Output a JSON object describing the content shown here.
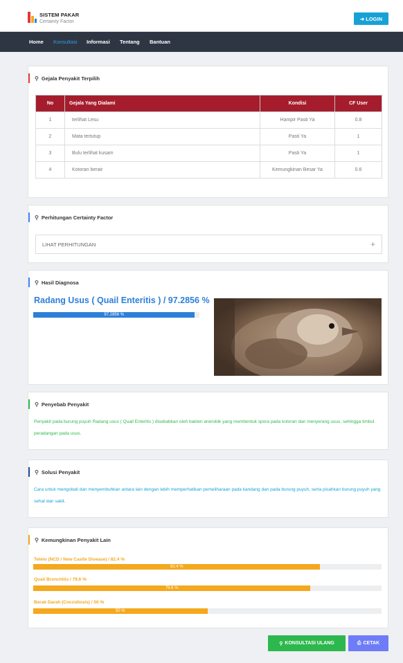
{
  "header": {
    "title": "SISTEM PAKAR",
    "subtitle": "Certainty Factor",
    "login_label": "LOGIN",
    "login_icon": "sign-in-icon"
  },
  "nav": {
    "items": [
      {
        "label": "Home"
      },
      {
        "label": "Konsultasi"
      },
      {
        "label": "Informasi"
      },
      {
        "label": "Tentang"
      },
      {
        "label": "Bantuan"
      }
    ]
  },
  "gejala": {
    "title": "Gejala Penyakit Terpilih",
    "columns": [
      "No",
      "Gejala Yang Dialami",
      "Kondisi",
      "CF User"
    ],
    "rows": [
      {
        "no": "1",
        "gejala": "terlihat Lesu",
        "kondisi": "Hampir Pasti Ya",
        "cf": "0.8"
      },
      {
        "no": "2",
        "gejala": "Mata tertutup",
        "kondisi": "Pasti Ya",
        "cf": "1"
      },
      {
        "no": "3",
        "gejala": "Bulu terlihat kusam",
        "kondisi": "Pasti Ya",
        "cf": "1"
      },
      {
        "no": "4",
        "gejala": "Kotoran berair",
        "kondisi": "Kemungkinan Besar Ya",
        "cf": "0.6"
      }
    ]
  },
  "perhitungan": {
    "title": "Perhitungan Certainty Factor",
    "accordion_label": "LIHAT PERHITUNGAN",
    "accordion_icon": "+"
  },
  "hasil": {
    "title": "Hasil Diagnosa",
    "diagnosis": "Radang Usus ( Quail Enteritis ) / 97.2856 %",
    "progress_value": 97.2856,
    "progress_label": "97.2856 %",
    "image_alt": "quail-photo"
  },
  "penyebab": {
    "title": "Penyebab Penyakit",
    "text": "Penyakit pada burung puyuh Radang usus ( Quail Enteritis ) disebabkan oleh bakteri anerobik yang membentuk spora pada kotoran dan menyerang usus, sehingga timbul peradangan pada usus."
  },
  "solusi": {
    "title": "Solusi Penyakit",
    "text": "Cara untuk mengobati dan menyembuhkan antara lain dengan lebih memperhatikan pemeliharaan pada kandang dan pada burung puyuh, serta pisahkan burung puyuh yang sehat dan sakit."
  },
  "lain": {
    "title": "Kemungkinan Penyakit Lain",
    "items": [
      {
        "label": "Tetelo (NCD / New Castle Disease) / 82.4 %",
        "value": 82.4,
        "bar_label": "82.4 %"
      },
      {
        "label": "Quail Bronchitis / 79.6 %",
        "value": 79.6,
        "bar_label": "79.6 %"
      },
      {
        "label": "Berak Darah (Coccidiosis) / 50 %",
        "value": 50,
        "bar_label": "50 %"
      }
    ]
  },
  "actions": {
    "konsultasi_label": "KONSULTASI ULANG",
    "cetak_label": "CETAK"
  },
  "colors": {
    "nav_bg": "#2f3643",
    "accent_blue": "#17a2d6",
    "table_header": "#a51d2d",
    "progress_blue": "#2d7fd9",
    "progress_orange": "#f4a81d",
    "green": "#2db84d",
    "purple": "#6f7cf7"
  }
}
